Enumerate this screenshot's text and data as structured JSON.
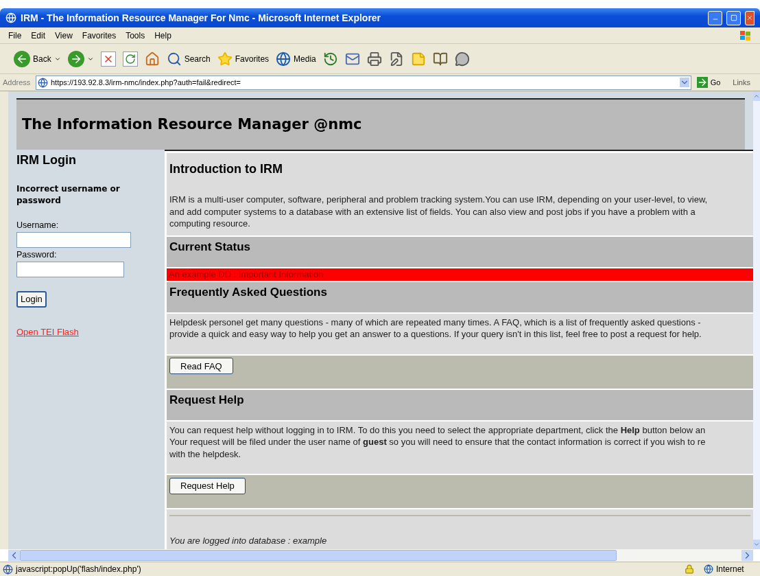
{
  "window": {
    "title": "IRM - The Information Resource Manager For Nmc - Microsoft Internet Explorer"
  },
  "menu": [
    "File",
    "Edit",
    "View",
    "Favorites",
    "Tools",
    "Help"
  ],
  "toolbar": [
    {
      "kind": "back",
      "label": "Back"
    },
    {
      "kind": "forward"
    },
    {
      "kind": "stop"
    },
    {
      "kind": "refresh"
    },
    {
      "kind": "home"
    },
    {
      "kind": "search",
      "label": "Search"
    },
    {
      "kind": "favorites",
      "label": "Favorites"
    },
    {
      "kind": "media",
      "label": "Media"
    },
    {
      "kind": "history"
    },
    {
      "kind": "mail"
    },
    {
      "kind": "print"
    },
    {
      "kind": "edit"
    },
    {
      "kind": "note"
    },
    {
      "kind": "research"
    },
    {
      "kind": "messenger"
    }
  ],
  "address": {
    "label": "Address",
    "url": "https://193.92.8.3/irm-nmc/index.php?auth=fail&redirect=",
    "go": "Go",
    "links": "Links"
  },
  "page": {
    "header_title": "The Information Resource Manager @nmc",
    "login": {
      "heading": "IRM Login",
      "error": "Incorrect username or password",
      "username_label": "Username:",
      "password_label": "Password:",
      "button": "Login",
      "link": "Open TEI Flash"
    },
    "blocks": [
      {
        "kind": "intro",
        "title": "Introduction to IRM",
        "lines": [
          "IRM is a multi-user computer, software, peripheral and problem tracking system.You can use IRM, depending on your user-level, to view,",
          "and add computer systems to a database with an extensive list of fields.  You can also view and post jobs if you have a problem with a",
          "computing resource."
        ]
      },
      {
        "kind": "heading",
        "title": "Current Status"
      },
      {
        "kind": "alert",
        "text": "An example DD : Important Information"
      },
      {
        "kind": "heading",
        "title": "Frequently Asked Questions"
      },
      {
        "kind": "text",
        "lines": [
          "Helpdesk personel get many questions - many of which are repeated many times. A FAQ, which is a list of frequently asked questions -",
          "provide a quick and easy way to help you get an answer to a questions. If your query isn't in this list, feel free to post a request for help."
        ]
      },
      {
        "kind": "action",
        "button": "Read FAQ"
      },
      {
        "kind": "heading",
        "title": "Request Help"
      },
      {
        "kind": "text",
        "lines": [
          "You can request help without logging in to IRM. To do this you need to select the appropriate department, click the **Help** button below an",
          "Your request will be filed under the user name of **guest** so you will need to ensure that the contact information is correct if you wish to re",
          "with the helpdesk."
        ]
      },
      {
        "kind": "action",
        "button": "Request Help"
      },
      {
        "kind": "footer",
        "text": "You are logged into database : example"
      }
    ]
  },
  "status_bar": {
    "text": "javascript:popUp('flash/index.php')",
    "zone": "Internet"
  }
}
